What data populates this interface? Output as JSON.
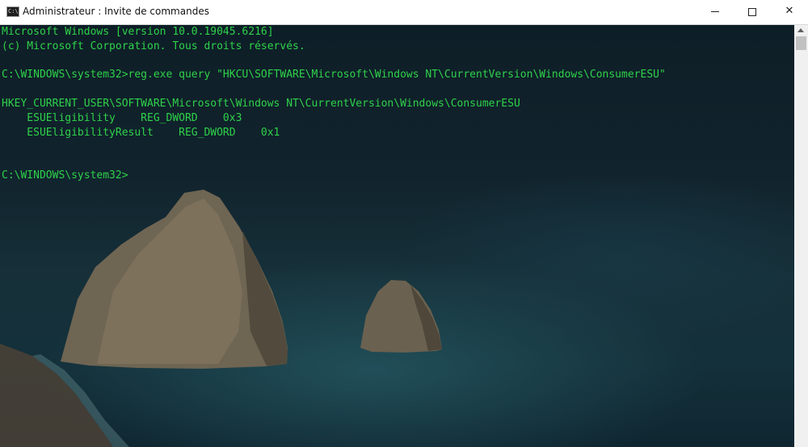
{
  "window": {
    "icon_glyph": "C:\\",
    "title": "Administrateur : Invite de commandes",
    "close_glyph": "✕"
  },
  "console": {
    "text_color": "#2fd24a",
    "lines": [
      "Microsoft Windows [version 10.0.19045.6216]",
      "(c) Microsoft Corporation. Tous droits réservés.",
      "",
      "C:\\WINDOWS\\system32>reg.exe query \"HKCU\\SOFTWARE\\Microsoft\\Windows NT\\CurrentVersion\\Windows\\ConsumerESU\"",
      "",
      "HKEY_CURRENT_USER\\SOFTWARE\\Microsoft\\Windows NT\\CurrentVersion\\Windows\\ConsumerESU",
      "    ESUEligibility    REG_DWORD    0x3",
      "    ESUEligibilityResult    REG_DWORD    0x1",
      "",
      "",
      "C:\\WINDOWS\\system32>"
    ]
  }
}
